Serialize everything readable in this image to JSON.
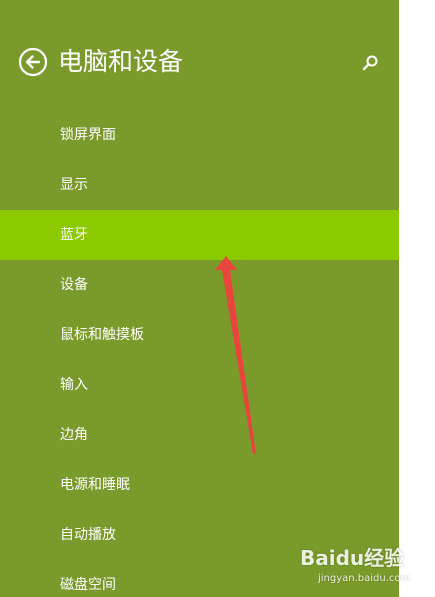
{
  "header": {
    "title": "电脑和设备",
    "back_icon": "back-arrow-circle-icon",
    "search_icon": "search-icon"
  },
  "menu": {
    "items": [
      {
        "label": "锁屏界面"
      },
      {
        "label": "显示"
      },
      {
        "label": "蓝牙",
        "selected": true
      },
      {
        "label": "设备"
      },
      {
        "label": "鼠标和触摸板"
      },
      {
        "label": "输入"
      },
      {
        "label": "边角"
      },
      {
        "label": "电源和睡眠"
      },
      {
        "label": "自动播放"
      },
      {
        "label": "磁盘空间"
      }
    ]
  },
  "colors": {
    "panel_bg": "#7a9b2b",
    "selected_bg": "#8bc900",
    "text": "#ffffff",
    "annotation_arrow": "#e8453c"
  },
  "watermark": {
    "mark": "Baidu经验",
    "url": "jingyan.baidu.com"
  }
}
